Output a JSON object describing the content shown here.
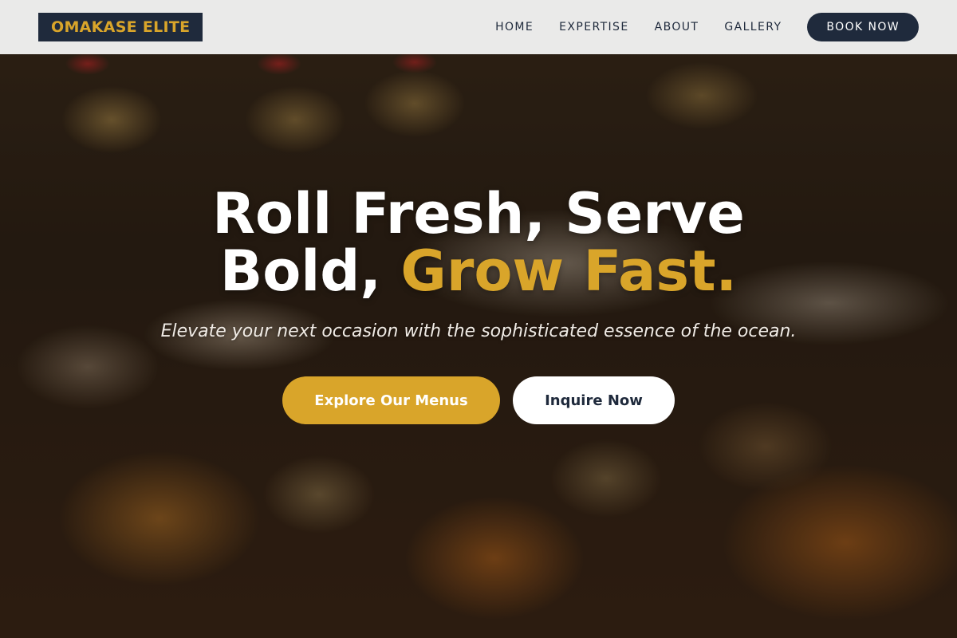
{
  "brand": {
    "logo_text": "OMAKASE ELITE"
  },
  "nav": {
    "items": [
      {
        "label": "HOME"
      },
      {
        "label": "EXPERTISE"
      },
      {
        "label": "ABOUT"
      },
      {
        "label": "GALLERY"
      }
    ],
    "cta_label": "BOOK NOW"
  },
  "hero": {
    "headline_line1": "Roll Fresh, Serve",
    "headline_line2_plain": "Bold,",
    "headline_line2_accent": "Grow Fast.",
    "subtitle": "Elevate your next occasion with the sophisticated essence of the ocean.",
    "primary_button": "Explore Our Menus",
    "secondary_button": "Inquire Now"
  },
  "colors": {
    "accent": "#d9a52a",
    "navy": "#1f2a3c",
    "nav_background": "#f3f3f3",
    "white": "#ffffff"
  }
}
